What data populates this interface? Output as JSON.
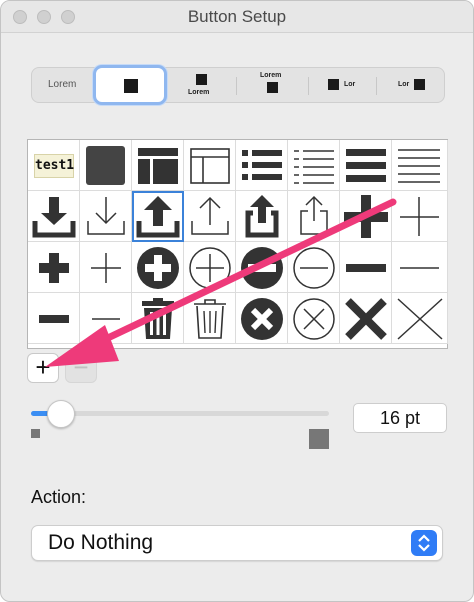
{
  "window": {
    "title": "Button Setup"
  },
  "segmented": {
    "options": [
      {
        "label": "Lorem"
      },
      {
        "label": ""
      },
      {
        "label": "Lorem"
      },
      {
        "label": "Lorem"
      },
      {
        "label": "Lor"
      },
      {
        "label": "Lor"
      }
    ],
    "selected_index": 1
  },
  "icon_grid": {
    "cells": [
      [
        "text-test1",
        "filled-square",
        "layout-header-icon",
        "layout-outline-icon",
        "list-bullets-bold-icon",
        "list-bullets-thin-icon",
        "lines-bold-icon",
        "lines-thin-icon"
      ],
      [
        "download-bold-icon",
        "download-thin-icon",
        "upload-bold-icon",
        "upload-thin-icon",
        "share-bold-icon",
        "share-thin-icon",
        "plus-bold-icon",
        "plus-thin-icon"
      ],
      [
        "plus-bold-icon",
        "plus-thin-icon",
        "plus-circle-filled-icon",
        "plus-circle-outline-icon",
        "minus-circle-filled-icon",
        "minus-circle-outline-icon",
        "minus-bold-icon",
        "minus-thin-icon"
      ],
      [
        "minus-bold-icon",
        "minus-thin-icon",
        "trash-bold-icon",
        "trash-thin-icon",
        "x-circle-filled-icon",
        "x-circle-outline-icon",
        "x-bold-icon",
        "x-thin-icon"
      ]
    ],
    "text_cell": "test1",
    "selected": {
      "row": 1,
      "col": 2
    }
  },
  "controls": {
    "add_label": "+",
    "remove_label": "−"
  },
  "size_slider": {
    "value_fraction": 0.1
  },
  "size_field": {
    "value": "16 pt"
  },
  "action": {
    "label": "Action:",
    "selected": "Do Nothing"
  },
  "colors": {
    "accent": "#2f7cf6",
    "annotation_arrow": "#ee3a7a",
    "window_bg": "#ececec"
  }
}
